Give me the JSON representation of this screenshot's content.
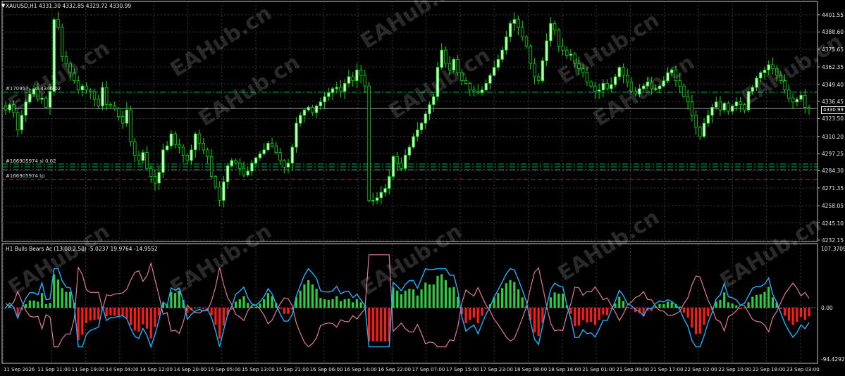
{
  "main_chart": {
    "symbol_header": "XAUUSD,H1  4331.30 4332.85 4329.72 4330.99",
    "current_price_tag": "4330.99",
    "price_ticks": [
      "4401.55",
      "4388.60",
      "4375.65",
      "4362.35",
      "4349.40",
      "4336.45",
      "4323.50",
      "4310.20",
      "4297.25",
      "4284.30",
      "4271.35",
      "4258.05",
      "4245.10",
      "4232.15"
    ],
    "trade_lines": [
      {
        "label": "#170957... sl 4346.02",
        "color": "#00b050",
        "style": "dashdot"
      },
      {
        "label": "#166905974 sl 0.02",
        "color": "#00b050",
        "style": "dashdot"
      },
      {
        "label": "#166905974 tp",
        "color": "#e0202c",
        "style": "dash"
      }
    ]
  },
  "indicator": {
    "header": "H1  Bulls Bears Ac (13.00,2.50) -5.0237 19.9764 -14.9552",
    "level_ticks": [
      "107.3709",
      "0.00",
      "-94.4292"
    ]
  },
  "time_axis": {
    "ticks": [
      "11 Sep 2026",
      "11 Sep 11:00",
      "11 Sep 19:00",
      "14 Sep 04:00",
      "14 Sep 12:00",
      "14 Sep 20:00",
      "15 Sep 05:00",
      "15 Sep 13:00",
      "15 Sep 21:00",
      "16 Sep 06:00",
      "16 Sep 14:00",
      "16 Sep 22:00",
      "17 Sep 07:00",
      "17 Sep 15:00",
      "17 Sep 23:00",
      "18 Sep 08:00",
      "18 Sep 16:00",
      "21 Sep 01:00",
      "21 Sep 09:00",
      "21 Sep 17:00",
      "22 Sep 02:00",
      "22 Sep 10:00",
      "22 Sep 18:00",
      "23 Sep 03:00"
    ]
  },
  "watermark": "EAHub.cn",
  "colors": {
    "background": "#000000",
    "grid": "#3a3a3a",
    "candle_up_body": "#c8ffc8",
    "candle_down_body": "#000000",
    "candle_outline": "#00e000",
    "hist_positive": "#2ecc40",
    "hist_negative": "#ff1a1a",
    "bulls_line": "#1ab2ff",
    "bears_line": "#e07a9a"
  },
  "chart_data": {
    "type": "candlestick",
    "symbol": "XAUUSD",
    "timeframe": "H1",
    "ohlc_header": {
      "open": 4331.3,
      "high": 4332.85,
      "low": 4329.72,
      "close": 4330.99
    },
    "price_range": [
      4232.15,
      4401.55
    ],
    "close_series": [
      4330,
      4334,
      4328,
      4315,
      4326,
      4336,
      4342,
      4346,
      4338,
      4339,
      4332,
      4344,
      4398,
      4392,
      4370,
      4365,
      4358,
      4352,
      4345,
      4348,
      4345,
      4344,
      4338,
      4333,
      4347,
      4334,
      4333,
      4331,
      4325,
      4320,
      4330,
      4306,
      4296,
      4292,
      4298,
      4286,
      4280,
      4275,
      4283,
      4300,
      4303,
      4312,
      4304,
      4302,
      4296,
      4292,
      4300,
      4312,
      4305,
      4300,
      4295,
      4280,
      4272,
      4262,
      4276,
      4288,
      4292,
      4290,
      4286,
      4281,
      4284,
      4290,
      4294,
      4297,
      4300,
      4305,
      4303,
      4298,
      4292,
      4287,
      4290,
      4302,
      4320,
      4326,
      4330,
      4332,
      4328,
      4333,
      4336,
      4340,
      4343,
      4346,
      4347,
      4344,
      4350,
      4355,
      4352,
      4360,
      4356,
      4348,
      4262,
      4262,
      4264,
      4268,
      4271,
      4280,
      4295,
      4290,
      4286,
      4296,
      4302,
      4310,
      4315,
      4320,
      4327,
      4334,
      4340,
      4362,
      4375,
      4365,
      4360,
      4368,
      4358,
      4352,
      4350,
      4345,
      4344,
      4343,
      4345,
      4350,
      4356,
      4362,
      4368,
      4375,
      4385,
      4395,
      4398,
      4392,
      4385,
      4378,
      4365,
      4355,
      4352,
      4367,
      4382,
      4395,
      4390,
      4378,
      4375,
      4371,
      4372,
      4365,
      4361,
      4358,
      4351,
      4348,
      4344,
      4345,
      4350,
      4346,
      4349,
      4355,
      4362,
      4356,
      4351,
      4344,
      4342,
      4346,
      4348,
      4351,
      4346,
      4346,
      4348,
      4352,
      4358,
      4360,
      4352,
      4348,
      4340,
      4336,
      4326,
      4317,
      4310,
      4320,
      4326,
      4332,
      4336,
      4330,
      4335,
      4329,
      4333,
      4336,
      4334,
      4330,
      4344,
      4347,
      4354,
      4358,
      4360,
      4364,
      4361,
      4356,
      4352,
      4345,
      4339,
      4336,
      4338,
      4341,
      4332,
      4331
    ],
    "indicator_series": [
      {
        "name": "Bulls Bears Ac",
        "parameters": "(13.00,2.50)",
        "values": [
          -5.0237,
          19.9764,
          -14.9552
        ]
      }
    ],
    "indicator_range": [
      -94.4292,
      107.3709
    ],
    "xlabel": "",
    "ylabel": ""
  }
}
